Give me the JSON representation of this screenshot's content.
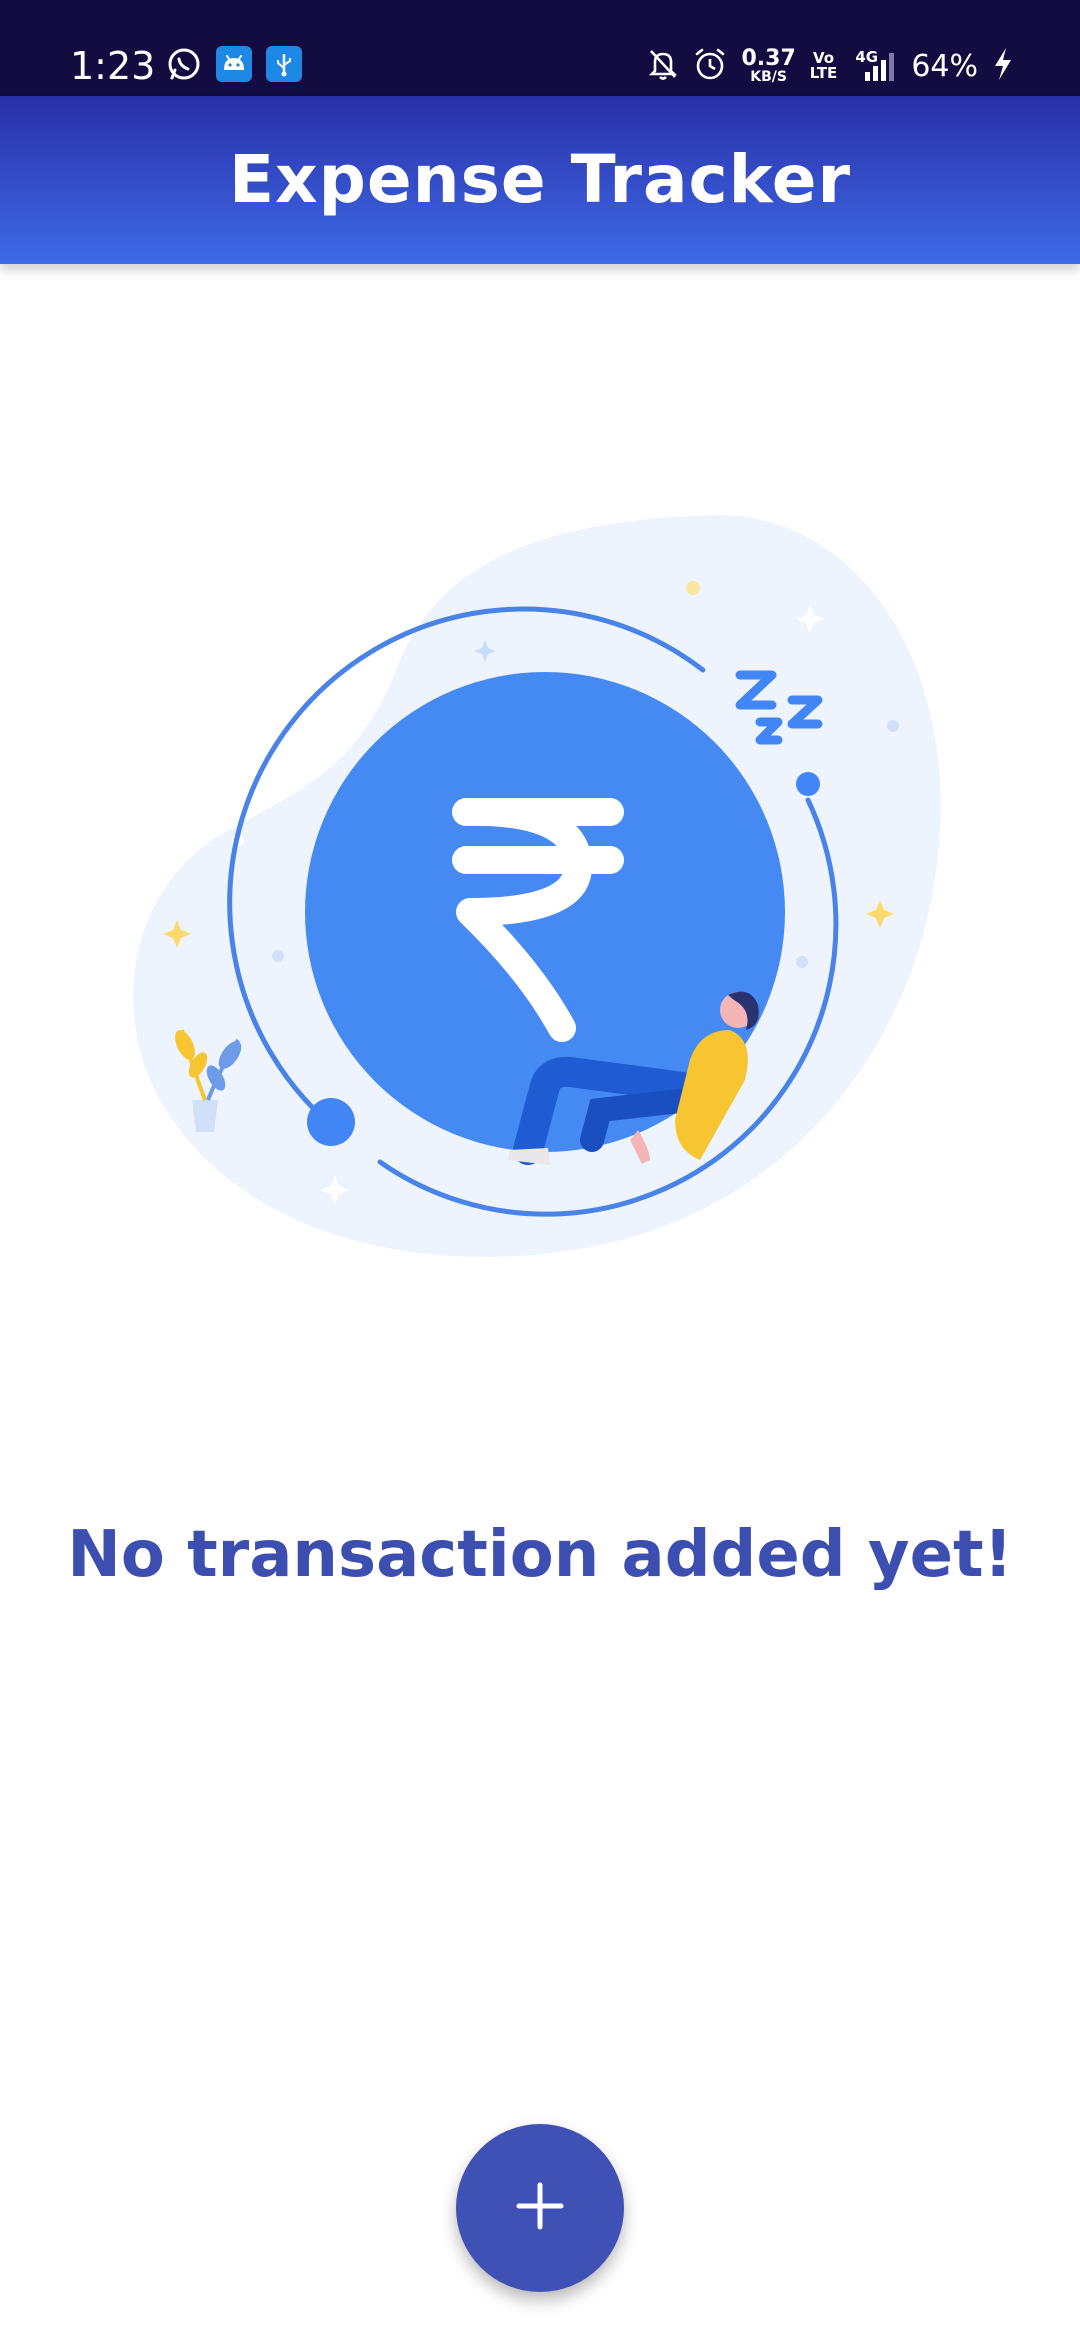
{
  "status_bar": {
    "time": "1:23",
    "network_speed": "0.37",
    "network_speed_unit": "KB/S",
    "volte_top": "Vo",
    "volte_bottom": "LTE",
    "network_type": "4G",
    "battery": "64%",
    "icons": [
      "whatsapp-icon",
      "android-icon",
      "usb-icon",
      "notifications-off-icon",
      "alarm-icon",
      "signal-icon",
      "charging-icon"
    ]
  },
  "app_bar": {
    "title": "Expense Tracker"
  },
  "empty_state": {
    "illustration": "sleeping-rupee-illustration",
    "message": "No transaction added yet!"
  },
  "fab": {
    "icon": "plus-icon"
  },
  "colors": {
    "status_bar": "#120c40",
    "app_bar_top": "#2a2fa8",
    "app_bar_bottom": "#3e6ae6",
    "accent": "#3f51b5",
    "message": "#3c4fb0",
    "illustration_blue": "#4285f4",
    "illustration_yellow": "#f7c531"
  }
}
